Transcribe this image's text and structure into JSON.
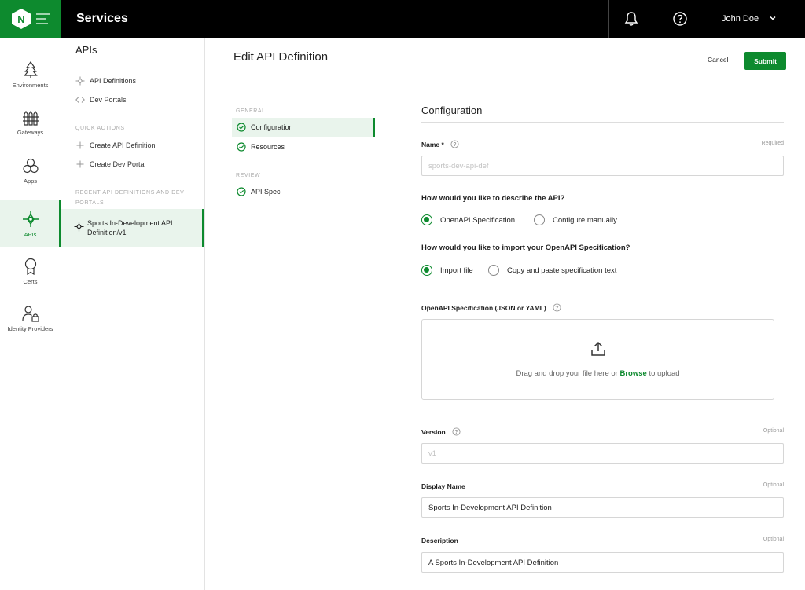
{
  "topbar": {
    "title": "Services",
    "user_name": "John Doe"
  },
  "rail": {
    "items": [
      {
        "label": "Environments",
        "icon": "tree-icon"
      },
      {
        "label": "Gateways",
        "icon": "fence-icon"
      },
      {
        "label": "Apps",
        "icon": "hexagons-icon"
      },
      {
        "label": "APIs",
        "icon": "api-icon",
        "active": true
      },
      {
        "label": "Certs",
        "icon": "badge-icon"
      },
      {
        "label": "Identity Providers",
        "icon": "user-lock-icon"
      }
    ]
  },
  "secnav": {
    "title": "APIs",
    "links": [
      {
        "label": "API Definitions",
        "icon": "api-icon"
      },
      {
        "label": "Dev Portals",
        "icon": "code-icon"
      }
    ],
    "quick_actions_heading": "QUICK ACTIONS",
    "quick_actions": [
      {
        "label": "Create API Definition",
        "icon": "plus-icon"
      },
      {
        "label": "Create Dev Portal",
        "icon": "plus-icon"
      }
    ],
    "recent_heading": "RECENT API DEFINITIONS AND DEV PORTALS",
    "recent_item": "Sports In-Development API Definition/v1"
  },
  "main": {
    "title": "Edit API Definition",
    "cancel_label": "Cancel",
    "submit_label": "Submit"
  },
  "steps": {
    "general_heading": "GENERAL",
    "configuration": "Configuration",
    "resources": "Resources",
    "review_heading": "REVIEW",
    "api_spec": "API Spec"
  },
  "form": {
    "section_title": "Configuration",
    "name_label": "Name *",
    "name_note": "Required",
    "name_placeholder": "sports-dev-api-def",
    "describe_question": "How would you like to describe the API?",
    "describe_options": [
      "OpenAPI Specification",
      "Configure manually"
    ],
    "describe_selected": "OpenAPI Specification",
    "import_question": "How would you like to import your OpenAPI Specification?",
    "import_options": [
      "Import file",
      "Copy and paste specification text"
    ],
    "import_selected": "Import file",
    "spec_label": "OpenAPI Specification (JSON or YAML)",
    "drop_text_before": "Drag and drop your file here or ",
    "drop_browse": "Browse",
    "drop_text_after": " to upload",
    "version_label": "Version",
    "version_note": "Optional",
    "version_placeholder": "v1",
    "display_name_label": "Display Name",
    "display_name_note": "Optional",
    "display_name_value": "Sports In-Development API Definition",
    "description_label": "Description",
    "description_note": "Optional",
    "description_value": "A Sports In-Development API Definition"
  },
  "colors": {
    "brand_green": "#0d8a2e",
    "active_bg": "#e9f4ec",
    "topbar_bg": "#000000"
  }
}
